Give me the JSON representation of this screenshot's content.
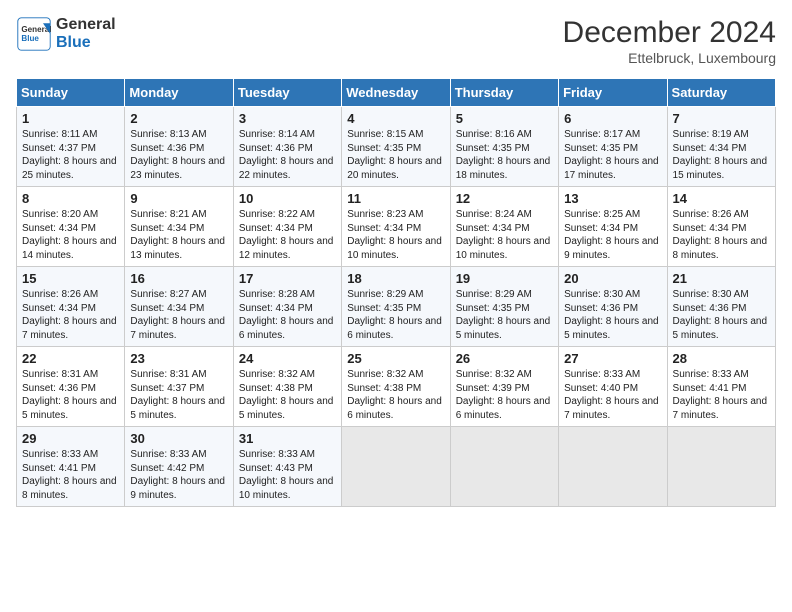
{
  "header": {
    "logo_general": "General",
    "logo_blue": "Blue",
    "month_title": "December 2024",
    "location": "Ettelbruck, Luxembourg"
  },
  "days_of_week": [
    "Sunday",
    "Monday",
    "Tuesday",
    "Wednesday",
    "Thursday",
    "Friday",
    "Saturday"
  ],
  "weeks": [
    [
      {
        "day": "1",
        "sunrise": "8:11 AM",
        "sunset": "4:37 PM",
        "daylight": "8 hours and 25 minutes."
      },
      {
        "day": "2",
        "sunrise": "8:13 AM",
        "sunset": "4:36 PM",
        "daylight": "8 hours and 23 minutes."
      },
      {
        "day": "3",
        "sunrise": "8:14 AM",
        "sunset": "4:36 PM",
        "daylight": "8 hours and 22 minutes."
      },
      {
        "day": "4",
        "sunrise": "8:15 AM",
        "sunset": "4:35 PM",
        "daylight": "8 hours and 20 minutes."
      },
      {
        "day": "5",
        "sunrise": "8:16 AM",
        "sunset": "4:35 PM",
        "daylight": "8 hours and 18 minutes."
      },
      {
        "day": "6",
        "sunrise": "8:17 AM",
        "sunset": "4:35 PM",
        "daylight": "8 hours and 17 minutes."
      },
      {
        "day": "7",
        "sunrise": "8:19 AM",
        "sunset": "4:34 PM",
        "daylight": "8 hours and 15 minutes."
      }
    ],
    [
      {
        "day": "8",
        "sunrise": "8:20 AM",
        "sunset": "4:34 PM",
        "daylight": "8 hours and 14 minutes."
      },
      {
        "day": "9",
        "sunrise": "8:21 AM",
        "sunset": "4:34 PM",
        "daylight": "8 hours and 13 minutes."
      },
      {
        "day": "10",
        "sunrise": "8:22 AM",
        "sunset": "4:34 PM",
        "daylight": "8 hours and 12 minutes."
      },
      {
        "day": "11",
        "sunrise": "8:23 AM",
        "sunset": "4:34 PM",
        "daylight": "8 hours and 10 minutes."
      },
      {
        "day": "12",
        "sunrise": "8:24 AM",
        "sunset": "4:34 PM",
        "daylight": "8 hours and 10 minutes."
      },
      {
        "day": "13",
        "sunrise": "8:25 AM",
        "sunset": "4:34 PM",
        "daylight": "8 hours and 9 minutes."
      },
      {
        "day": "14",
        "sunrise": "8:26 AM",
        "sunset": "4:34 PM",
        "daylight": "8 hours and 8 minutes."
      }
    ],
    [
      {
        "day": "15",
        "sunrise": "8:26 AM",
        "sunset": "4:34 PM",
        "daylight": "8 hours and 7 minutes."
      },
      {
        "day": "16",
        "sunrise": "8:27 AM",
        "sunset": "4:34 PM",
        "daylight": "8 hours and 7 minutes."
      },
      {
        "day": "17",
        "sunrise": "8:28 AM",
        "sunset": "4:34 PM",
        "daylight": "8 hours and 6 minutes."
      },
      {
        "day": "18",
        "sunrise": "8:29 AM",
        "sunset": "4:35 PM",
        "daylight": "8 hours and 6 minutes."
      },
      {
        "day": "19",
        "sunrise": "8:29 AM",
        "sunset": "4:35 PM",
        "daylight": "8 hours and 5 minutes."
      },
      {
        "day": "20",
        "sunrise": "8:30 AM",
        "sunset": "4:36 PM",
        "daylight": "8 hours and 5 minutes."
      },
      {
        "day": "21",
        "sunrise": "8:30 AM",
        "sunset": "4:36 PM",
        "daylight": "8 hours and 5 minutes."
      }
    ],
    [
      {
        "day": "22",
        "sunrise": "8:31 AM",
        "sunset": "4:36 PM",
        "daylight": "8 hours and 5 minutes."
      },
      {
        "day": "23",
        "sunrise": "8:31 AM",
        "sunset": "4:37 PM",
        "daylight": "8 hours and 5 minutes."
      },
      {
        "day": "24",
        "sunrise": "8:32 AM",
        "sunset": "4:38 PM",
        "daylight": "8 hours and 5 minutes."
      },
      {
        "day": "25",
        "sunrise": "8:32 AM",
        "sunset": "4:38 PM",
        "daylight": "8 hours and 6 minutes."
      },
      {
        "day": "26",
        "sunrise": "8:32 AM",
        "sunset": "4:39 PM",
        "daylight": "8 hours and 6 minutes."
      },
      {
        "day": "27",
        "sunrise": "8:33 AM",
        "sunset": "4:40 PM",
        "daylight": "8 hours and 7 minutes."
      },
      {
        "day": "28",
        "sunrise": "8:33 AM",
        "sunset": "4:41 PM",
        "daylight": "8 hours and 7 minutes."
      }
    ],
    [
      {
        "day": "29",
        "sunrise": "8:33 AM",
        "sunset": "4:41 PM",
        "daylight": "8 hours and 8 minutes."
      },
      {
        "day": "30",
        "sunrise": "8:33 AM",
        "sunset": "4:42 PM",
        "daylight": "8 hours and 9 minutes."
      },
      {
        "day": "31",
        "sunrise": "8:33 AM",
        "sunset": "4:43 PM",
        "daylight": "8 hours and 10 minutes."
      },
      null,
      null,
      null,
      null
    ]
  ],
  "labels": {
    "sunrise": "Sunrise:",
    "sunset": "Sunset:",
    "daylight": "Daylight:"
  }
}
